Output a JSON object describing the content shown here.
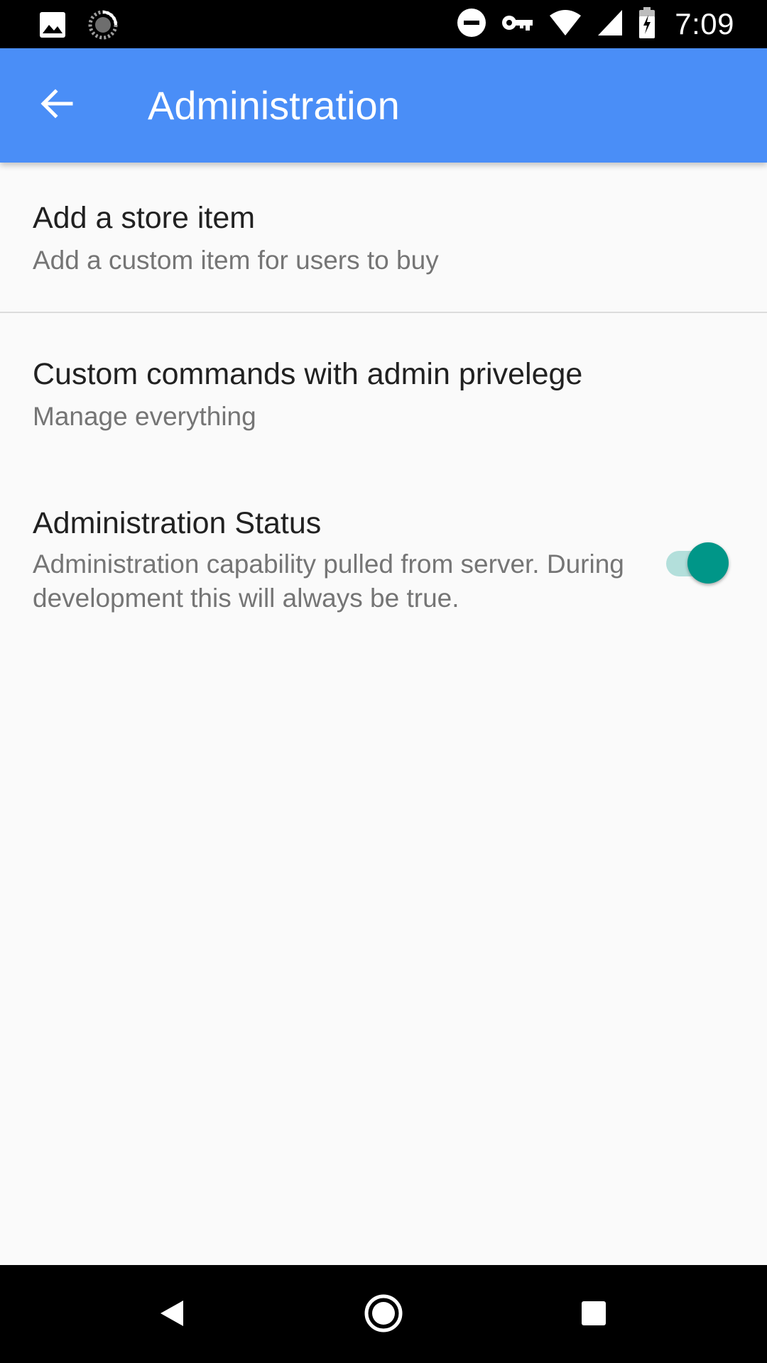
{
  "status_bar": {
    "time": "7:09",
    "left_icons": [
      "image-notification-icon",
      "sync-progress-icon"
    ],
    "right_icons": [
      "do-not-disturb-icon",
      "vpn-key-icon",
      "wifi-icon",
      "cell-signal-icon",
      "battery-charging-icon"
    ]
  },
  "app_bar": {
    "title": "Administration",
    "back_icon": "arrow-back-icon",
    "color": "#4a8ef7"
  },
  "preferences": [
    {
      "title": "Add a store item",
      "summary": "Add a custom item for users to buy"
    },
    {
      "title": "Custom commands with admin privelege",
      "summary": "Manage everything"
    },
    {
      "title": "Administration Status",
      "summary": "Administration capability pulled from server. During development this will always be true.",
      "switch_on": true,
      "switch_color": "#009688"
    }
  ],
  "nav_bar": {
    "buttons": [
      "back-triangle-icon",
      "home-circle-icon",
      "recents-square-icon"
    ]
  }
}
